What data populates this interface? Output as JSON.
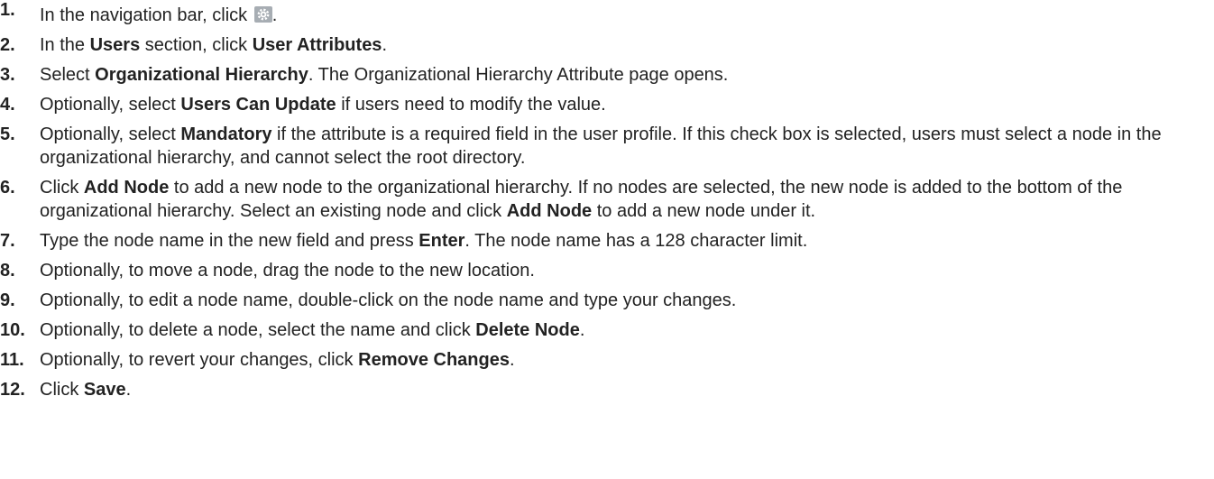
{
  "steps": [
    {
      "number": "1.",
      "parts": [
        {
          "text": "In the navigation bar, click ",
          "bold": false
        },
        {
          "icon": "gear-icon"
        },
        {
          "text": ".",
          "bold": false
        }
      ]
    },
    {
      "number": "2.",
      "parts": [
        {
          "text": "In the ",
          "bold": false
        },
        {
          "text": "Users",
          "bold": true
        },
        {
          "text": " section, click ",
          "bold": false
        },
        {
          "text": "User Attributes",
          "bold": true
        },
        {
          "text": ".",
          "bold": false
        }
      ]
    },
    {
      "number": "3.",
      "parts": [
        {
          "text": "Select ",
          "bold": false
        },
        {
          "text": "Organizational Hierarchy",
          "bold": true
        },
        {
          "text": ". The Organizational Hierarchy Attribute page opens.",
          "bold": false
        }
      ]
    },
    {
      "number": "4.",
      "parts": [
        {
          "text": "Optionally, select ",
          "bold": false
        },
        {
          "text": "Users Can Update",
          "bold": true
        },
        {
          "text": " if users need to modify the value.",
          "bold": false
        }
      ]
    },
    {
      "number": "5.",
      "parts": [
        {
          "text": "Optionally, select ",
          "bold": false
        },
        {
          "text": "Mandatory",
          "bold": true
        },
        {
          "text": " if the attribute is a required field in the user profile. If this check box is selected, users must select a node in the organizational hierarchy, and cannot select the root directory.",
          "bold": false
        }
      ]
    },
    {
      "number": "6.",
      "parts": [
        {
          "text": "Click ",
          "bold": false
        },
        {
          "text": "Add Node",
          "bold": true
        },
        {
          "text": " to add a new node to the organizational hierarchy. If no nodes are selected, the new node is added to the bottom of the organizational hierarchy. Select an existing node and click ",
          "bold": false
        },
        {
          "text": "Add Node",
          "bold": true
        },
        {
          "text": " to add a new node under it.",
          "bold": false
        }
      ]
    },
    {
      "number": "7.",
      "parts": [
        {
          "text": "Type the node name in the new field and press ",
          "bold": false
        },
        {
          "text": "Enter",
          "bold": true
        },
        {
          "text": ". The node name has a 128 character limit.",
          "bold": false
        }
      ]
    },
    {
      "number": "8.",
      "parts": [
        {
          "text": "Optionally, to move a node, drag the node to the new location.",
          "bold": false
        }
      ]
    },
    {
      "number": "9.",
      "parts": [
        {
          "text": "Optionally, to edit a node name, double-click on the node name and type your changes.",
          "bold": false
        }
      ]
    },
    {
      "number": "10.",
      "parts": [
        {
          "text": "Optionally, to delete a node, select the name and click ",
          "bold": false
        },
        {
          "text": "Delete Node",
          "bold": true
        },
        {
          "text": ".",
          "bold": false
        }
      ]
    },
    {
      "number": "11.",
      "parts": [
        {
          "text": "Optionally, to revert your changes, click ",
          "bold": false
        },
        {
          "text": "Remove Changes",
          "bold": true
        },
        {
          "text": ".",
          "bold": false
        }
      ]
    },
    {
      "number": "12.",
      "parts": [
        {
          "text": "Click ",
          "bold": false
        },
        {
          "text": "Save",
          "bold": true
        },
        {
          "text": ".",
          "bold": false
        }
      ]
    }
  ]
}
